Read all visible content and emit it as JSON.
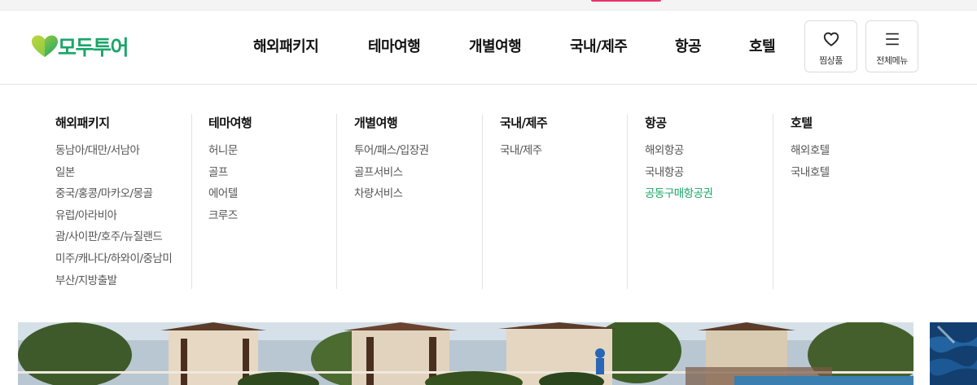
{
  "brand": {
    "name": "모두투어",
    "accent_color": "#1aa56a",
    "logo_icon": "heart-logo-icon"
  },
  "gnb": {
    "items": [
      {
        "label": "해외패키지"
      },
      {
        "label": "테마여행"
      },
      {
        "label": "개별여행"
      },
      {
        "label": "국내/제주"
      },
      {
        "label": "항공"
      },
      {
        "label": "호텔"
      }
    ]
  },
  "utilities": {
    "wishlist": {
      "label": "찜상품",
      "icon": "heart-icon"
    },
    "all_menu": {
      "label": "전체메뉴",
      "icon": "hamburger-menu-icon"
    }
  },
  "mega_menu": {
    "columns": [
      {
        "title": "해외패키지",
        "items": [
          "동남아/대만/서남아",
          "일본",
          "중국/홍콩/마카오/몽골",
          "유럽/아라비아",
          "괌/사이판/호주/뉴질랜드",
          "미주/캐나다/하와이/중남미",
          "부산/지방출발"
        ]
      },
      {
        "title": "테마여행",
        "items": [
          "허니문",
          "골프",
          "에어텔",
          "크루즈"
        ]
      },
      {
        "title": "개별여행",
        "items": [
          "투어/패스/입장권",
          "골프서비스",
          "차량서비스"
        ]
      },
      {
        "title": "국내/제주",
        "items": [
          "국내/제주"
        ]
      },
      {
        "title": "항공",
        "items": [
          "해외항공",
          "국내항공",
          "공동구매항공권"
        ],
        "highlighted_item": "공동구매항공권"
      },
      {
        "title": "호텔",
        "items": [
          "해외호텔",
          "국내호텔"
        ]
      }
    ]
  },
  "colors": {
    "highlight": "#1aa56a",
    "top_tab": "#e8336d"
  }
}
